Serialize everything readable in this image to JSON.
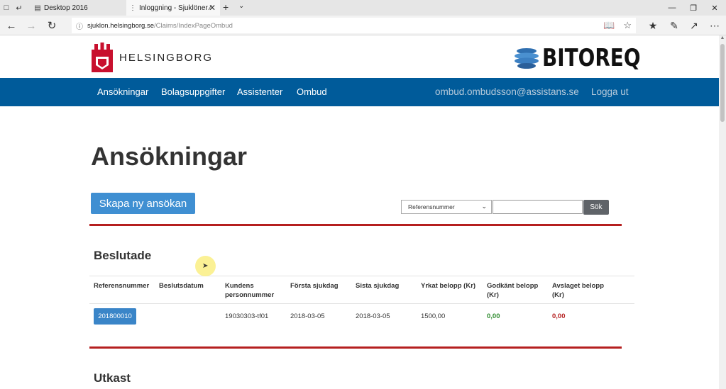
{
  "browser": {
    "tabs": [
      {
        "label": "Desktop 2016",
        "active": false
      },
      {
        "label": "Inloggning - Sjuklöner ⁄",
        "active": true
      }
    ],
    "url_domain": "sjuklon.helsingborg.se",
    "url_path": "/Claims/IndexPageOmbud"
  },
  "header": {
    "brand_name": "HELSINGBORG",
    "partner_logo": "BITOREQ"
  },
  "nav": {
    "items": [
      "Ansökningar",
      "Bolagsuppgifter",
      "Assistenter",
      "Ombud"
    ],
    "user_email": "ombud.ombudsson@assistans.se",
    "logout_label": "Logga ut"
  },
  "page": {
    "title": "Ansökningar",
    "create_button": "Skapa ny ansökan",
    "search": {
      "selected_field": "Referensnummer",
      "input_value": "",
      "button_label": "Sök"
    }
  },
  "sections": {
    "decided": {
      "title": "Beslutade",
      "columns": [
        "Referensnummer",
        "Beslutsdatum",
        "Kundens personnummer",
        "Första sjukdag",
        "Sista sjukdag",
        "Yrkat belopp (Kr)",
        "Godkänt belopp (Kr)",
        "Avslaget belopp (Kr)"
      ],
      "rows": [
        {
          "reference": "201800010",
          "decision_date": "",
          "customer_id": "19030303-tf01",
          "first_sick_day": "2018-03-05",
          "last_sick_day": "2018-03-05",
          "claimed": "1500,00",
          "approved": "0,00",
          "rejected": "0,00"
        }
      ]
    },
    "draft": {
      "title": "Utkast"
    }
  },
  "colors": {
    "nav_bg": "#005b9a",
    "primary_button": "#3f8fd2",
    "divider_red": "#b51f1f",
    "approved_green": "#2e8b2e",
    "rejected_red": "#b51f1f"
  }
}
